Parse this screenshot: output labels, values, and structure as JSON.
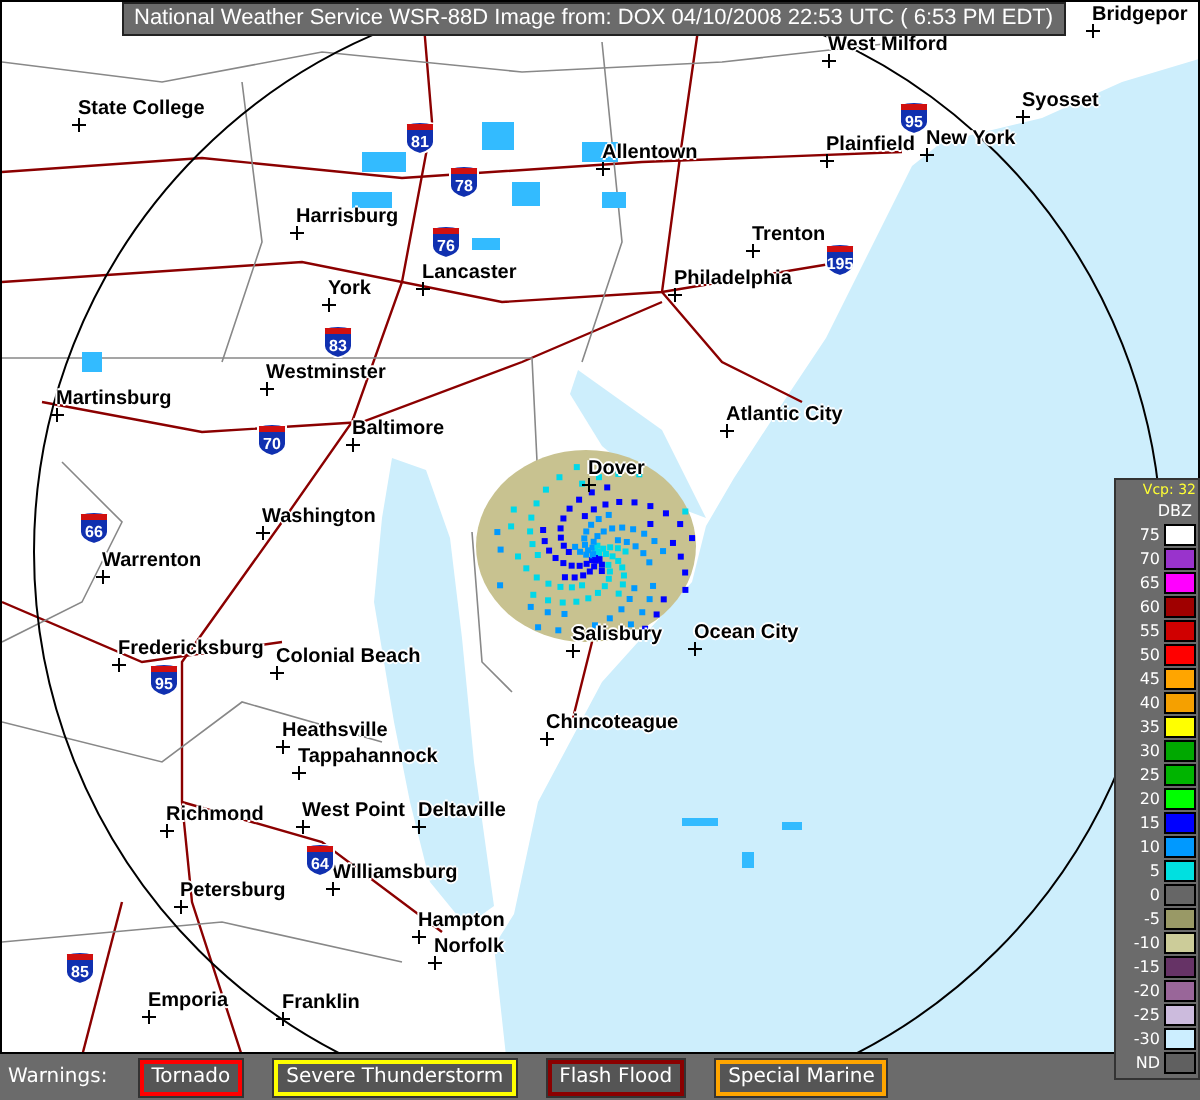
{
  "title": "National Weather Service WSR-88D Image from: DOX 04/10/2008 22:53 UTC ( 6:53 PM EDT)",
  "map": {
    "cities": [
      {
        "name": "West Milford"
      },
      {
        "name": "Bridgepor"
      },
      {
        "name": "State College"
      },
      {
        "name": "Syosset"
      },
      {
        "name": "Allentown"
      },
      {
        "name": "Plainfield"
      },
      {
        "name": "New York"
      },
      {
        "name": "Harrisburg"
      },
      {
        "name": "Trenton"
      },
      {
        "name": "Lancaster"
      },
      {
        "name": "York"
      },
      {
        "name": "Philadelphia"
      },
      {
        "name": "Westminster"
      },
      {
        "name": "Martinsburg"
      },
      {
        "name": "Atlantic City"
      },
      {
        "name": "Baltimore"
      },
      {
        "name": "Dover"
      },
      {
        "name": "Washington"
      },
      {
        "name": "Warrenton"
      },
      {
        "name": "Salisbury"
      },
      {
        "name": "Ocean City"
      },
      {
        "name": "Fredericksburg"
      },
      {
        "name": "Colonial Beach"
      },
      {
        "name": "Heathsville"
      },
      {
        "name": "Chincoteague"
      },
      {
        "name": "Tappahannock"
      },
      {
        "name": "Richmond"
      },
      {
        "name": "West Point"
      },
      {
        "name": "Deltaville"
      },
      {
        "name": "Williamsburg"
      },
      {
        "name": "Petersburg"
      },
      {
        "name": "Hampton"
      },
      {
        "name": "Norfolk"
      },
      {
        "name": "Emporia"
      },
      {
        "name": "Franklin"
      }
    ],
    "shields": [
      {
        "label": "81"
      },
      {
        "label": "95"
      },
      {
        "label": "78"
      },
      {
        "label": "76"
      },
      {
        "label": "195"
      },
      {
        "label": "83"
      },
      {
        "label": "70"
      },
      {
        "label": "66"
      },
      {
        "label": "95"
      },
      {
        "label": "64"
      },
      {
        "label": "85"
      }
    ]
  },
  "legend": {
    "vcp": "Vcp: 32",
    "unit": "DBZ",
    "levels": [
      {
        "label": "75",
        "color": "#ffffff"
      },
      {
        "label": "70",
        "color": "#9933cc"
      },
      {
        "label": "65",
        "color": "#ff00ff"
      },
      {
        "label": "60",
        "color": "#a00000"
      },
      {
        "label": "55",
        "color": "#d00000"
      },
      {
        "label": "50",
        "color": "#ff0000"
      },
      {
        "label": "45",
        "color": "#ffa500"
      },
      {
        "label": "40",
        "color": "#f5a000"
      },
      {
        "label": "35",
        "color": "#ffff00"
      },
      {
        "label": "30",
        "color": "#00a800"
      },
      {
        "label": "25",
        "color": "#00b400"
      },
      {
        "label": "20",
        "color": "#00ff00"
      },
      {
        "label": "15",
        "color": "#0000ff"
      },
      {
        "label": "10",
        "color": "#0099ff"
      },
      {
        "label": "5",
        "color": "#00e0e0"
      },
      {
        "label": "0",
        "color": "#666666"
      },
      {
        "label": "-5",
        "color": "#999966"
      },
      {
        "label": "-10",
        "color": "#cccc99"
      },
      {
        "label": "-15",
        "color": "#663366"
      },
      {
        "label": "-20",
        "color": "#996699"
      },
      {
        "label": "-25",
        "color": "#ccbbdd"
      },
      {
        "label": "-30",
        "color": "#cceeff"
      },
      {
        "label": "ND",
        "color": "#606060"
      }
    ]
  },
  "warnings": {
    "label": "Warnings:",
    "items": [
      {
        "label": "Tornado",
        "color": "#ff0000"
      },
      {
        "label": "Severe Thunderstorm",
        "color": "#ffff00"
      },
      {
        "label": "Flash Flood",
        "color": "#8b0000"
      },
      {
        "label": "Special Marine",
        "color": "#ffa500"
      }
    ]
  }
}
